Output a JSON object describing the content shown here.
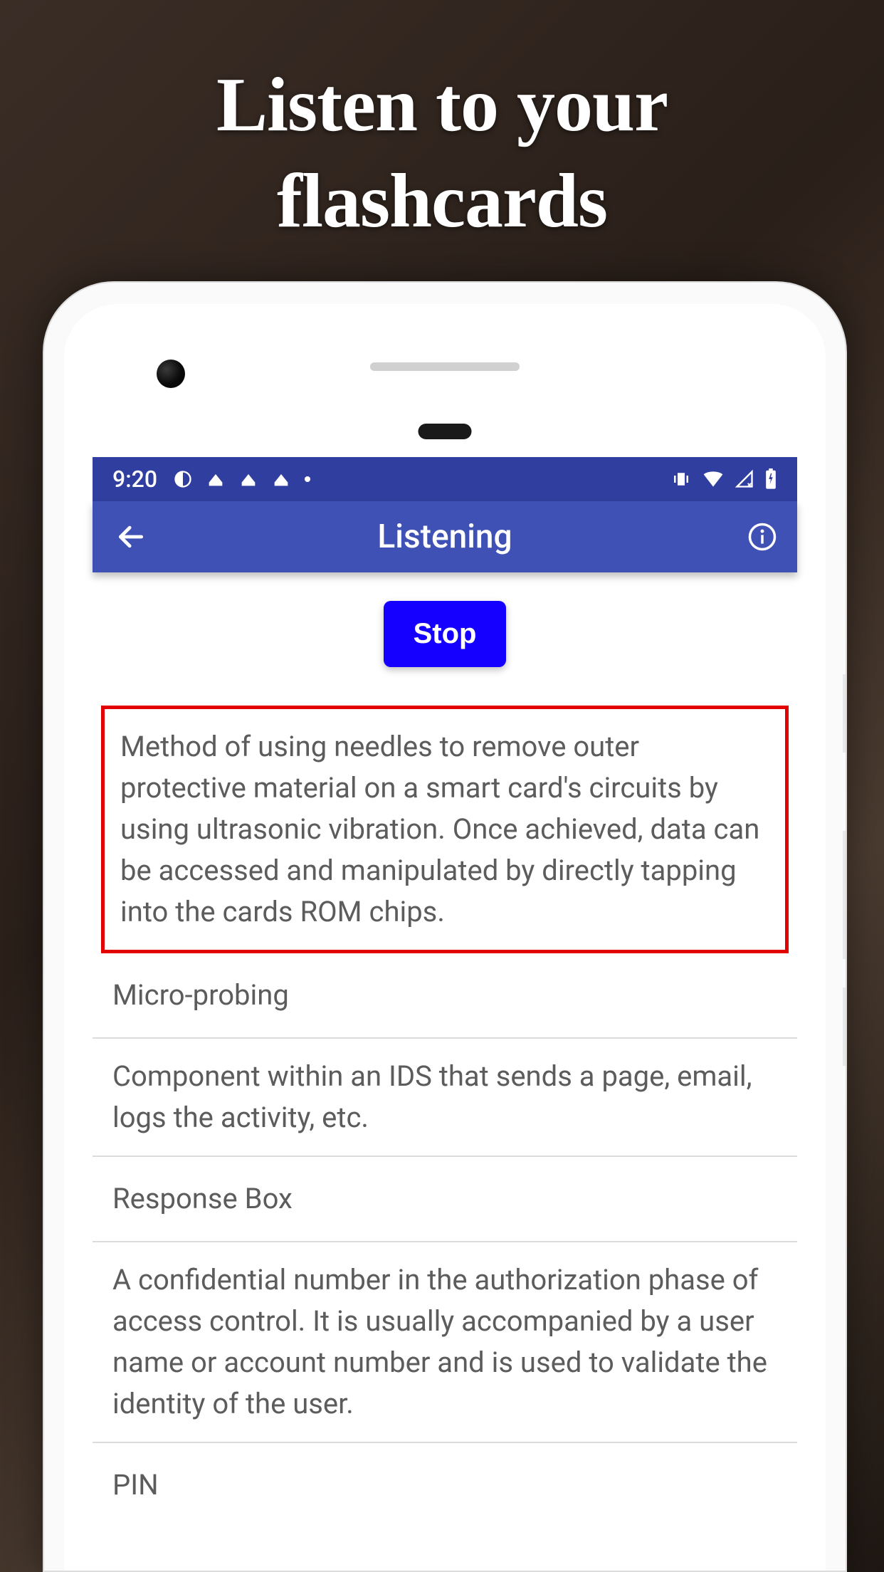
{
  "marketing": {
    "headline_line1": "Listen to your",
    "headline_line2": "flashcards"
  },
  "statusbar": {
    "time": "9:20"
  },
  "appbar": {
    "title": "Listening"
  },
  "controls": {
    "stop_label": "Stop"
  },
  "cards": [
    {
      "type": "question",
      "current": true,
      "text": "Method of using needles to remove outer protective material on a smart card's circuits by using ultrasonic vibration. Once achieved, data can be accessed and manipulated by directly tapping into the cards ROM chips."
    },
    {
      "type": "answer",
      "current": false,
      "text": "Micro-probing"
    },
    {
      "type": "question",
      "current": false,
      "text": "Component within an IDS that sends a page, email, logs the activity, etc."
    },
    {
      "type": "answer",
      "current": false,
      "text": "Response Box"
    },
    {
      "type": "question",
      "current": false,
      "text": "A confidential number in the authorization phase of access control. It is usually accompanied by a user name or account number and is used to validate the identity of the user."
    },
    {
      "type": "answer",
      "current": false,
      "text": "PIN"
    }
  ]
}
